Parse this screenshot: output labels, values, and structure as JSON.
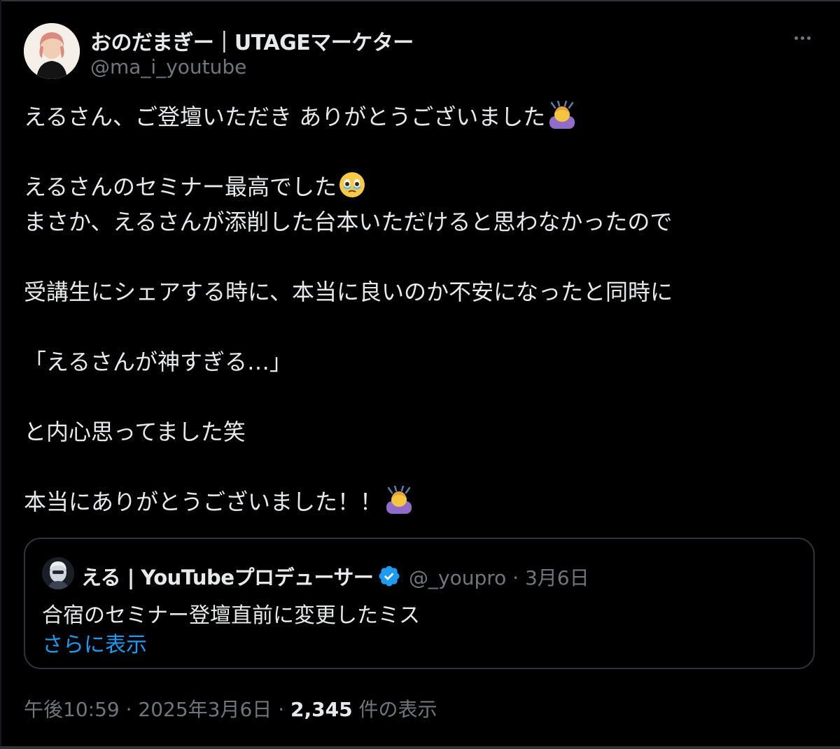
{
  "author": {
    "name": "おのだまぎー｜UTAGEマーケター",
    "handle": "@ma_i_youtube"
  },
  "more_icon": "more-horizontal-icon",
  "tweet": {
    "lines": [
      "えるさん、ご登壇いただき ありがとうございました",
      "",
      "えるさんのセミナー最高でした",
      "まさか、えるさんが添削した台本いただけると思わなかったので",
      "",
      "受講生にシェアする時に、本当に良いのか不安になったと同時に",
      "",
      "「えるさんが神すぎる…」",
      "",
      "と内心思ってました笑",
      "",
      "本当にありがとうございました！！"
    ],
    "emojis": {
      "line_0": "person-bowing-emoji",
      "line_2": "face-holding-back-tears-emoji",
      "line_11": "person-bowing-emoji"
    }
  },
  "quote": {
    "author_name": "える | YouTubeプロデューサー",
    "verified_icon": "verified-badge-icon",
    "verified_color": "#1d9bf0",
    "handle": "@_youpro",
    "separator": " · ",
    "date": "3月6日",
    "text": "合宿のセミナー登壇直前に変更したミス",
    "show_more": "さらに表示"
  },
  "footer": {
    "time": "午後10:59",
    "separator": " · ",
    "date": "2025年3月6日",
    "views_count": "2,345",
    "views_label": " 件の表示"
  },
  "colors": {
    "background": "#000000",
    "text": "#e7e9ea",
    "muted": "#71767b",
    "link": "#1d9bf0",
    "border": "#2f3336"
  }
}
